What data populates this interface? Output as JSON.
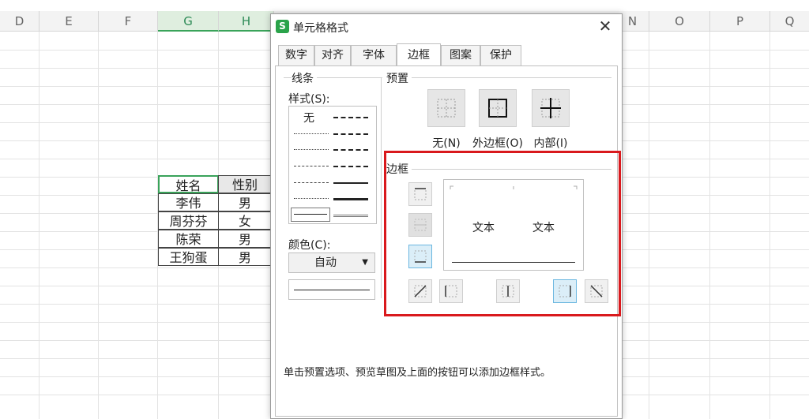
{
  "sheet": {
    "columns": [
      "D",
      "E",
      "F",
      "G",
      "H",
      "",
      "",
      "",
      "N",
      "O",
      "P",
      "Q"
    ],
    "table": {
      "headers": [
        "姓名",
        "性别"
      ],
      "rows": [
        [
          "李伟",
          "男"
        ],
        [
          "周芬芬",
          "女"
        ],
        [
          "陈荣",
          "男"
        ],
        [
          "王狗蛋",
          "男"
        ]
      ]
    }
  },
  "dialog": {
    "title": "单元格格式",
    "close": "✕",
    "tabs": [
      "数字",
      "对齐",
      "字体",
      "边框",
      "图案",
      "保护"
    ],
    "active_tab": "边框",
    "line_group": "线条",
    "style_label": "样式(S):",
    "style_none": "无",
    "color_label": "颜色(C):",
    "color_value": "自动",
    "preset_group": "预置",
    "presets": [
      "无(N)",
      "外边框(O)",
      "内部(I)"
    ],
    "border_group": "边框",
    "preview_texts": [
      "文本",
      "文本"
    ],
    "hint": "单击预置选项、预览草图及上面的按钮可以添加边框样式。"
  },
  "colors": {
    "highlight": "#d9191d",
    "accent": "#3aa35a",
    "active_border": "#6bb7e0"
  }
}
